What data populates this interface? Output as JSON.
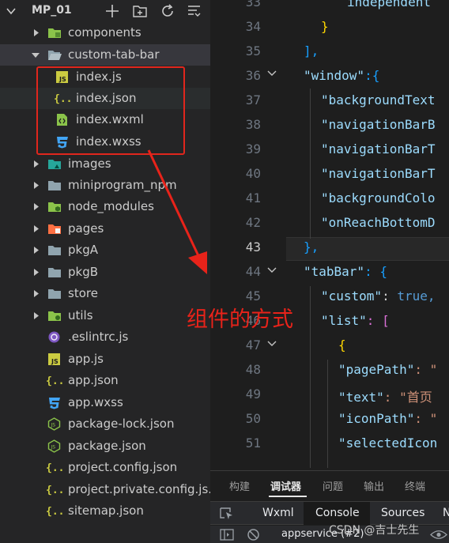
{
  "explorer": {
    "project_name": "MP_01",
    "tree": [
      {
        "label": "components",
        "kind": "folder",
        "icon": "components-folder-icon",
        "color": "#8bc34a"
      },
      {
        "label": "custom-tab-bar",
        "kind": "folder-open",
        "icon": "folder-open-icon",
        "color": "#90a4ae"
      },
      {
        "label": "index.js",
        "kind": "file",
        "icon": "js-file-icon",
        "color": "#cbcb41"
      },
      {
        "label": "index.json",
        "kind": "file",
        "icon": "json-file-icon",
        "color": "#cbcb41"
      },
      {
        "label": "index.wxml",
        "kind": "file",
        "icon": "wxml-file-icon",
        "color": "#8bc34a"
      },
      {
        "label": "index.wxss",
        "kind": "file",
        "icon": "css-file-icon",
        "color": "#42a5f5"
      },
      {
        "label": "images",
        "kind": "folder",
        "icon": "images-folder-icon",
        "color": "#26a69a"
      },
      {
        "label": "miniprogram_npm",
        "kind": "folder",
        "icon": "folder-icon",
        "color": "#90a4ae"
      },
      {
        "label": "node_modules",
        "kind": "folder",
        "icon": "node-folder-icon",
        "color": "#8bc34a"
      },
      {
        "label": "pages",
        "kind": "folder",
        "icon": "pages-folder-icon",
        "color": "#ff7043"
      },
      {
        "label": "pkgA",
        "kind": "folder",
        "icon": "folder-icon",
        "color": "#90a4ae"
      },
      {
        "label": "pkgB",
        "kind": "folder",
        "icon": "folder-icon",
        "color": "#90a4ae"
      },
      {
        "label": "store",
        "kind": "folder",
        "icon": "folder-icon",
        "color": "#90a4ae"
      },
      {
        "label": "utils",
        "kind": "folder",
        "icon": "utils-folder-icon",
        "color": "#8bc34a"
      },
      {
        "label": ".eslintrc.js",
        "kind": "file",
        "icon": "eslint-file-icon",
        "color": "#7e57c2"
      },
      {
        "label": "app.js",
        "kind": "file",
        "icon": "js-file-icon",
        "color": "#cbcb41"
      },
      {
        "label": "app.json",
        "kind": "file",
        "icon": "json-file-icon",
        "color": "#cbcb41"
      },
      {
        "label": "app.wxss",
        "kind": "file",
        "icon": "css-file-icon",
        "color": "#42a5f5"
      },
      {
        "label": "package-lock.json",
        "kind": "file",
        "icon": "npm-file-icon",
        "color": "#8bc34a"
      },
      {
        "label": "package.json",
        "kind": "file",
        "icon": "npm-file-icon",
        "color": "#8bc34a"
      },
      {
        "label": "project.config.json",
        "kind": "file",
        "icon": "json-file-icon",
        "color": "#cbcb41"
      },
      {
        "label": "project.private.config.js...",
        "kind": "file",
        "icon": "json-file-icon",
        "color": "#cbcb41"
      },
      {
        "label": "sitemap.json",
        "kind": "file",
        "icon": "json-file-icon",
        "color": "#cbcb41"
      }
    ]
  },
  "editor": {
    "line_numbers": [
      "33",
      "34",
      "35",
      "36",
      "37",
      "38",
      "39",
      "40",
      "41",
      "42",
      "43",
      "44",
      "45",
      "46",
      "47",
      "48",
      "49",
      "50",
      "51"
    ],
    "current_line": "43",
    "code": {
      "l33": "independent",
      "l34": "}",
      "l35": "],",
      "l36_key": "\"window\"",
      "l36_rest": ":{",
      "l37": "\"backgroundText",
      "l38": "\"navigationBarB",
      "l39": "\"navigationBarT",
      "l40": "\"navigationBarT",
      "l41": "\"backgroundColo",
      "l42": "\"onReachBottomD",
      "l43": "},",
      "l44_key": "\"tabBar\"",
      "l44_rest": ": {",
      "l45_key": "\"custom\"",
      "l45_colon": ": ",
      "l45_val": "true,",
      "l46_key": "\"list\"",
      "l46_rest": ": [",
      "l47": "{",
      "l48_key": "\"pagePath\"",
      "l48_rest": ": \"",
      "l49_key": "\"text\"",
      "l49_rest": ": \"首页",
      "l50_key": "\"iconPath\"",
      "l50_rest": ": \"",
      "l51_key": "\"selectedIcon"
    }
  },
  "annotation": {
    "text": "组件的方式",
    "color": "#e8231a"
  },
  "panel": {
    "tabs": [
      "构建",
      "调试器",
      "问题",
      "输出",
      "终端"
    ],
    "active_tab": "调试器",
    "devtools_tabs": [
      "Wxml",
      "Console",
      "Sources",
      "N"
    ],
    "active_devtools_tab": "Console",
    "context_select": "appservice (#2)",
    "watermark": "CSDN @吉士先生"
  },
  "colors": {
    "accent_red": "#e0261d",
    "sidebar_bg": "#252526",
    "editor_bg": "#1e1e1e"
  }
}
